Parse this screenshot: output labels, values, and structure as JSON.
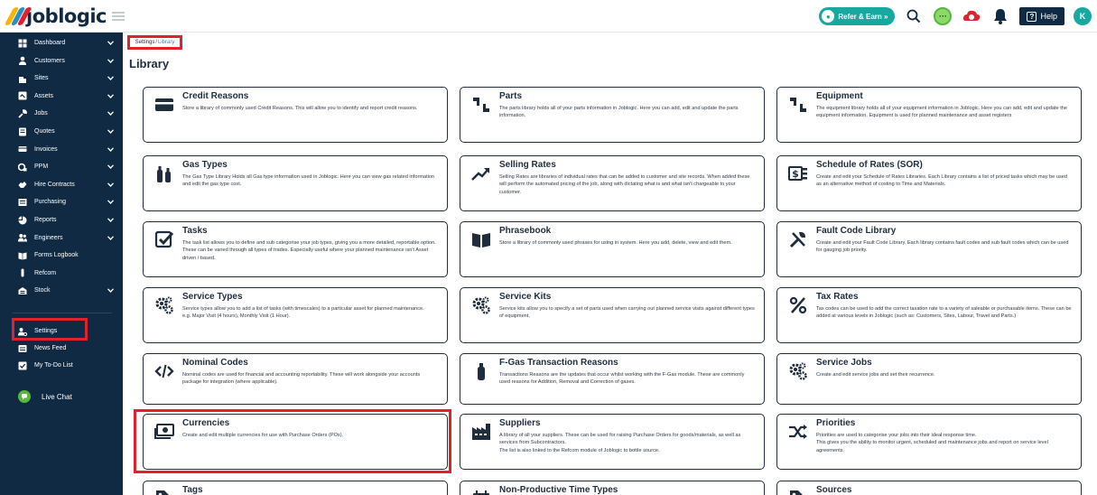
{
  "header": {
    "logo_text": "joblogic",
    "refer_label": "Refer & Earn »",
    "help_label": "Help",
    "avatar_initial": "K",
    "colors": {
      "accent": "#17a9a0",
      "navy": "#102a43",
      "highlight": "#e3202e"
    }
  },
  "sidebar": {
    "items": [
      {
        "label": "Dashboard",
        "icon": "dashboard-icon",
        "has_chevron": true
      },
      {
        "label": "Customers",
        "icon": "user-icon",
        "has_chevron": true
      },
      {
        "label": "Sites",
        "icon": "building-icon",
        "has_chevron": true
      },
      {
        "label": "Assets",
        "icon": "asset-icon",
        "has_chevron": true
      },
      {
        "label": "Jobs",
        "icon": "wrench-icon",
        "has_chevron": true
      },
      {
        "label": "Quotes",
        "icon": "quote-icon",
        "has_chevron": true
      },
      {
        "label": "Invoices",
        "icon": "invoice-icon",
        "has_chevron": true
      },
      {
        "label": "PPM",
        "icon": "ppm-icon",
        "has_chevron": true
      },
      {
        "label": "Hire Contracts",
        "icon": "contract-icon",
        "has_chevron": true
      },
      {
        "label": "Purchasing",
        "icon": "purchasing-icon",
        "has_chevron": true
      },
      {
        "label": "Reports",
        "icon": "reports-icon",
        "has_chevron": true
      },
      {
        "label": "Engineers",
        "icon": "engineers-icon",
        "has_chevron": true
      },
      {
        "label": "Forms Logbook",
        "icon": "logbook-icon",
        "has_chevron": false
      },
      {
        "label": "Refcom",
        "icon": "refcom-icon",
        "has_chevron": false
      },
      {
        "label": "Stock",
        "icon": "stock-icon",
        "has_chevron": true
      }
    ],
    "bottom_items": [
      {
        "label": "Settings",
        "icon": "settings-icon"
      },
      {
        "label": "News Feed",
        "icon": "newsfeed-icon"
      },
      {
        "label": "My To-Do List",
        "icon": "todo-icon"
      }
    ],
    "live_chat_label": "Live Chat"
  },
  "main": {
    "breadcrumb": {
      "settings": "Settings",
      "separator": "/",
      "library": "Library"
    },
    "title": "Library",
    "cards": [
      {
        "title": "Credit Reasons",
        "icon": "credit-card-icon",
        "description": "Store a library of commonly used Credit Reasons. This will allow you to identify and report credit reasons."
      },
      {
        "title": "Parts",
        "icon": "parts-icon",
        "description": "The parts library holds all of your parts information in Joblogic. Here you can add, edit and update the parts information."
      },
      {
        "title": "Equipment",
        "icon": "equipment-icon",
        "description": "The equipment library holds all of your equipment information in Joblogic. Here you can add, edit and update the equipment information. Equipment is used for planned maintenance and asset registers"
      },
      {
        "title": "Gas Types",
        "icon": "gas-cylinder-icon",
        "description": "The Gas Type Library Holds all Gas type information used in Joblogic. Here you can view gas related information and edit the gas type cost."
      },
      {
        "title": "Selling Rates",
        "icon": "trend-up-icon",
        "description": "Selling Rates are libraries of individual rates that can be added to customer and site records. When added these will perform the automated pricing of the job, along with dictating what is and what isn't chargeable to your customer."
      },
      {
        "title": "Schedule of Rates (SOR)",
        "icon": "money-list-icon",
        "description": "Create and edit your Schedule of Rates Libraries. Each Library contains a list of priced tasks which may be used as an alternative method of costing to Time and Materials."
      },
      {
        "title": "Tasks",
        "icon": "checkbox-icon",
        "description": "The task list allows you to define and sub categorise your job types, giving you a more detailed, reportable option. These can be varied through all types of trades. Especially useful where your planned maintenance isn't Asset driven / based."
      },
      {
        "title": "Phrasebook",
        "icon": "book-icon",
        "description": "Store a library of commonly used phrases for using in system. Here you add, delete, view and edit them."
      },
      {
        "title": "Fault Code Library",
        "icon": "tools-icon",
        "description": "Create and edit your Fault Code Library. Each library contains fault codes and sub fault codes which can be used for gauging job priority."
      },
      {
        "title": "Service Types",
        "icon": "gears-icon",
        "description": "Service types allow you to add a list of tasks (with timescales) to a particular asset for planned maintenance.\ne.g. Major Visit (4 hours), Monthly Visit (1 Hour)."
      },
      {
        "title": "Service Kits",
        "icon": "gears-icon",
        "description": "Service kits allow you to specify a set of parts used when carrying out planned service visits against different types of equipment."
      },
      {
        "title": "Tax Rates",
        "icon": "percent-icon",
        "description": "Tax codes can be used to add the correct taxation rate to a variety of saleable or purchasable items. These can be added at various levels in Joblogic (such as: Customers, Sites, Labour, Travel and Parts.)"
      },
      {
        "title": "Nominal Codes",
        "icon": "code-icon",
        "description": "Nominal codes are used for financial and accounting reportability. These will work alongside your accounts package for integration (where applicable)."
      },
      {
        "title": "F-Gas Transaction Reasons",
        "icon": "fgas-cylinder-icon",
        "description": "Transactions Reasons are the updates that occur whilst working with the F-Gas module. These are commonly used reasons for Addition, Removal and Correction of gases."
      },
      {
        "title": "Service Jobs",
        "icon": "gears-icon",
        "description": "Create and edit service jobs and set their recurrence."
      },
      {
        "title": "Currencies",
        "icon": "money-bill-icon",
        "description": "Create and edit multiple currencies for use with Purchase Orders (POs)."
      },
      {
        "title": "Suppliers",
        "icon": "industry-icon",
        "description": "A library of all your suppliers. These can be used for raising Purchase Orders for goods/materials, as well as services from Subcontractors.\nThe list is also linked to the Refcom module of Joblogic to bottle source."
      },
      {
        "title": "Priorities",
        "icon": "shuffle-icon",
        "description": "Priorities are used to categorise your jobs into their ideal response time.\nThis gives you the ability to monitor urgent, scheduled and maintenance jobs and report on service level agreements."
      },
      {
        "title": "Tags",
        "icon": "tag-icon",
        "description": ""
      },
      {
        "title": "Non-Productive Time Types",
        "icon": "calendar-icon",
        "description": ""
      },
      {
        "title": "Sources",
        "icon": "tag-icon",
        "description": ""
      }
    ]
  }
}
